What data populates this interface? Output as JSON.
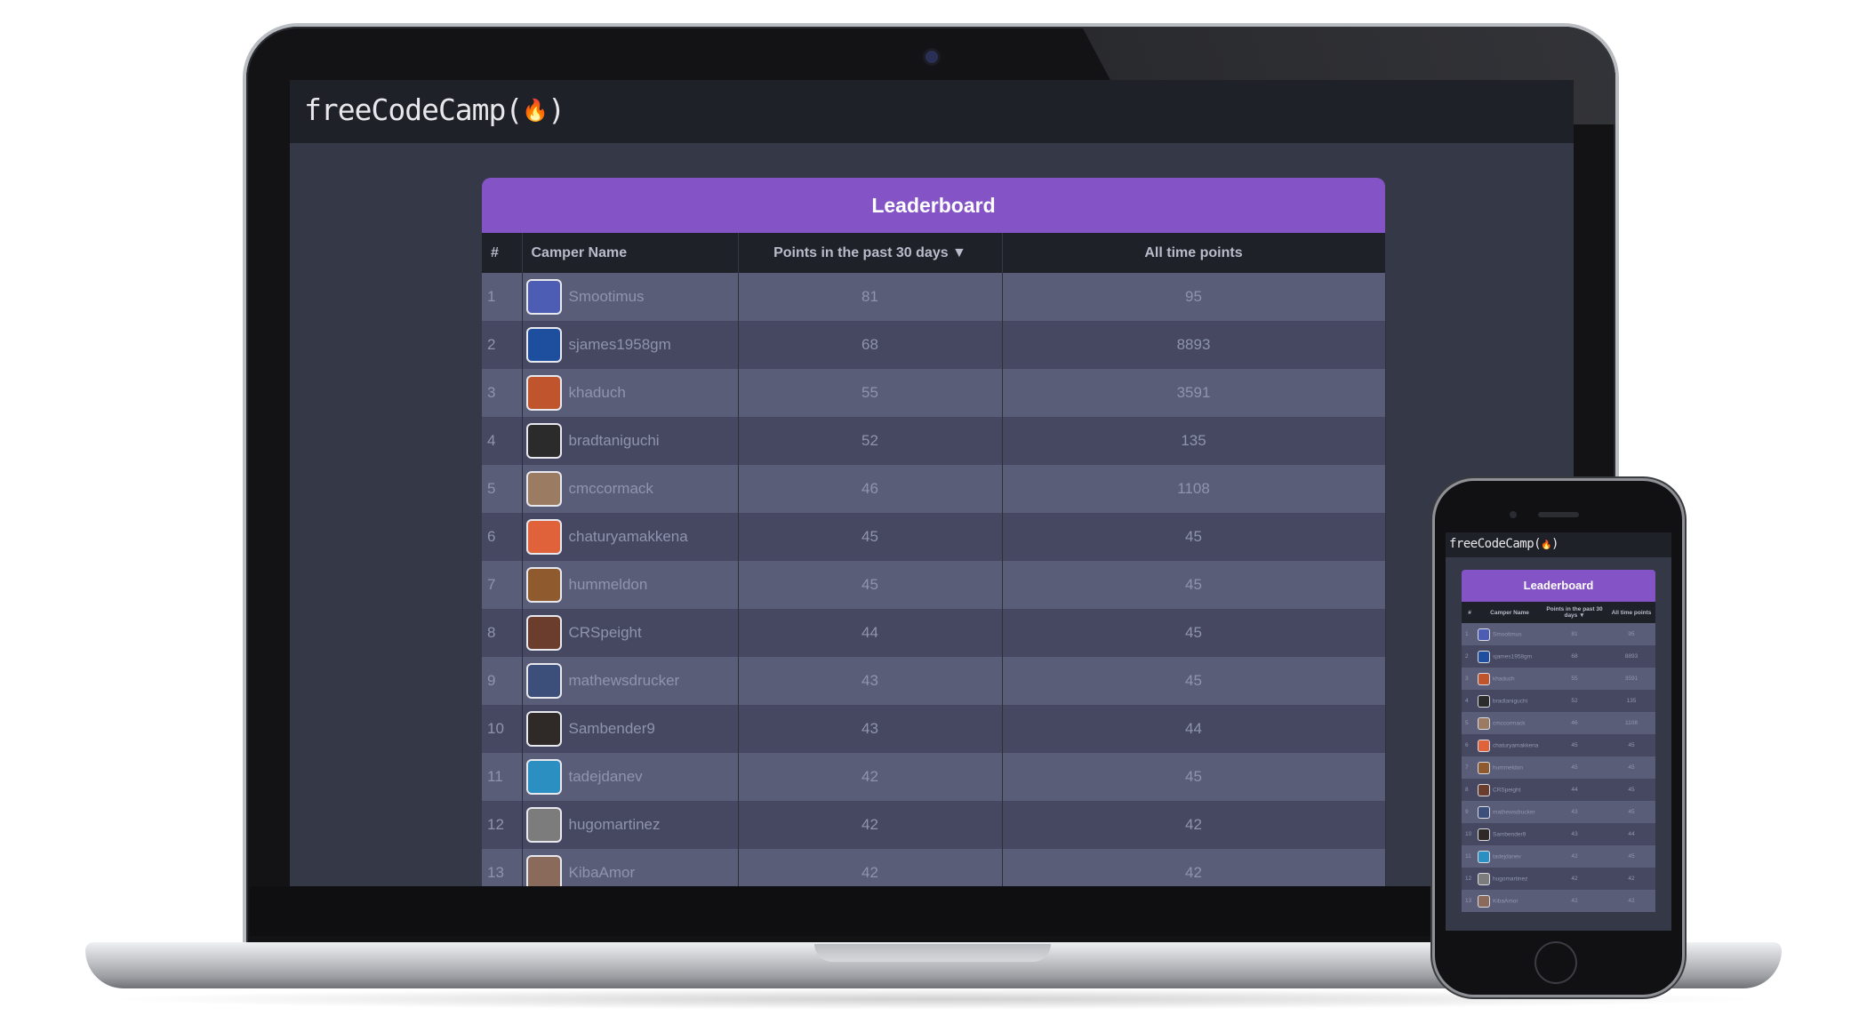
{
  "app": {
    "brand": "freeCodeCamp(",
    "brand_icon": "flame-icon",
    "brand_close": ")"
  },
  "leaderboard": {
    "title": "Leaderboard",
    "columns": {
      "rank": "#",
      "name": "Camper Name",
      "recent": "Points in the past 30 days ▼",
      "alltime": "All time points"
    },
    "rows": [
      {
        "rank": "1",
        "name": "Smootimus",
        "recent": "81",
        "alltime": "95",
        "avatar_color": "#4d5db3"
      },
      {
        "rank": "2",
        "name": "sjames1958gm",
        "recent": "68",
        "alltime": "8893",
        "avatar_color": "#1d4f9e"
      },
      {
        "rank": "3",
        "name": "khaduch",
        "recent": "55",
        "alltime": "3591",
        "avatar_color": "#c0542d"
      },
      {
        "rank": "4",
        "name": "bradtaniguchi",
        "recent": "52",
        "alltime": "135",
        "avatar_color": "#2b2b2b"
      },
      {
        "rank": "5",
        "name": "cmccormack",
        "recent": "46",
        "alltime": "1108",
        "avatar_color": "#9b7c62"
      },
      {
        "rank": "6",
        "name": "chaturyamakkena",
        "recent": "45",
        "alltime": "45",
        "avatar_color": "#e0623a"
      },
      {
        "rank": "7",
        "name": "hummeldon",
        "recent": "45",
        "alltime": "45",
        "avatar_color": "#8e5a2e"
      },
      {
        "rank": "8",
        "name": "CRSpeight",
        "recent": "44",
        "alltime": "45",
        "avatar_color": "#6b3d2d"
      },
      {
        "rank": "9",
        "name": "mathewsdrucker",
        "recent": "43",
        "alltime": "45",
        "avatar_color": "#3b4f7a"
      },
      {
        "rank": "10",
        "name": "Sambender9",
        "recent": "43",
        "alltime": "44",
        "avatar_color": "#2f2a28"
      },
      {
        "rank": "11",
        "name": "tadejdanev",
        "recent": "42",
        "alltime": "45",
        "avatar_color": "#2c8fc2"
      },
      {
        "rank": "12",
        "name": "hugomartinez",
        "recent": "42",
        "alltime": "42",
        "avatar_color": "#7c7c7c"
      },
      {
        "rank": "13",
        "name": "KibaAmor",
        "recent": "42",
        "alltime": "42",
        "avatar_color": "#8a6a5a"
      }
    ]
  },
  "phone": {
    "brand": "freeCodeCamp(",
    "brand_close": ")",
    "columns": {
      "rank": "#",
      "name": "Camper Name",
      "recent": "Points in the past 30 days ▼",
      "alltime": "All time points"
    }
  },
  "colors": {
    "accent": "#8454c7",
    "nav": "#1f2128",
    "page": "#353846",
    "row_odd": "#5a5d78",
    "row_even": "#454860"
  }
}
